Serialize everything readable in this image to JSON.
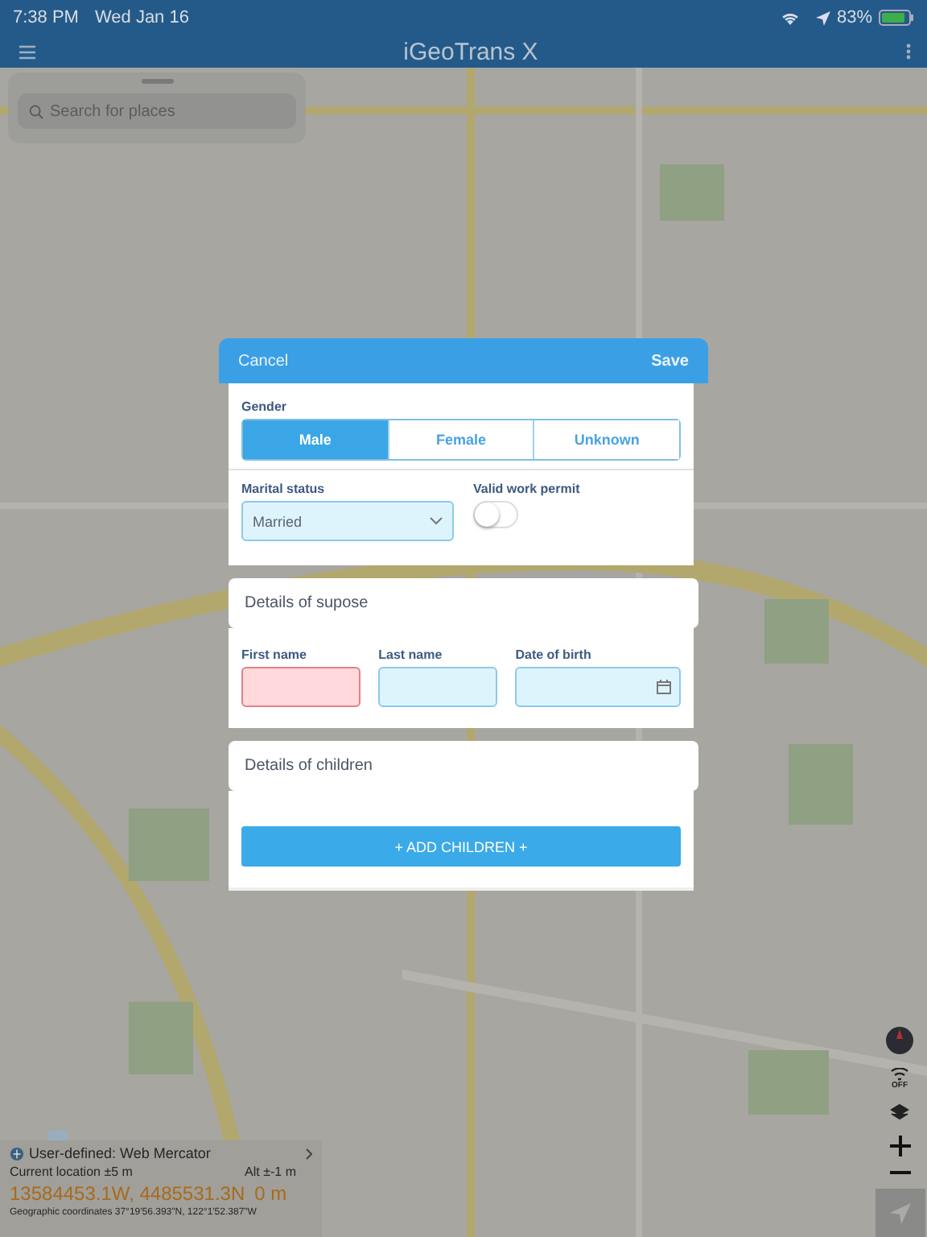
{
  "status_bar": {
    "time": "7:38 PM",
    "date": "Wed Jan 16",
    "battery": "83%"
  },
  "app_bar": {
    "title": "iGeoTrans X"
  },
  "search": {
    "placeholder": "Search for places"
  },
  "dialog": {
    "cancel": "Cancel",
    "save": "Save",
    "gender": {
      "label": "Gender",
      "options": [
        {
          "label": "Male",
          "selected": true
        },
        {
          "label": "Female",
          "selected": false
        },
        {
          "label": "Unknown",
          "selected": false
        }
      ]
    },
    "marital_status": {
      "label": "Marital status",
      "value": "Married"
    },
    "work_permit": {
      "label": "Valid work permit",
      "on": false
    },
    "spouse": {
      "title": "Details of supose",
      "fields": [
        {
          "label": "First name",
          "kind": "text",
          "invalid": true
        },
        {
          "label": "Last name",
          "kind": "text",
          "invalid": false
        },
        {
          "label": "Date of birth",
          "kind": "date",
          "invalid": false
        }
      ]
    },
    "children": {
      "title": "Details of children",
      "add_button": "+ ADD CHILDREN +"
    }
  },
  "location_panel": {
    "projection": "User-defined: Web Mercator",
    "location_label": "Current location ±5 m",
    "altitude_label": "Alt ±-1 m",
    "coordinates": "13584453.1W, 4485531.3N",
    "altitude": "0 m",
    "geographic": "Geographic coordinates 37°19'56.393\"N, 122°1'52.387\"W"
  },
  "map_controls": {
    "tracking": "OFF"
  }
}
